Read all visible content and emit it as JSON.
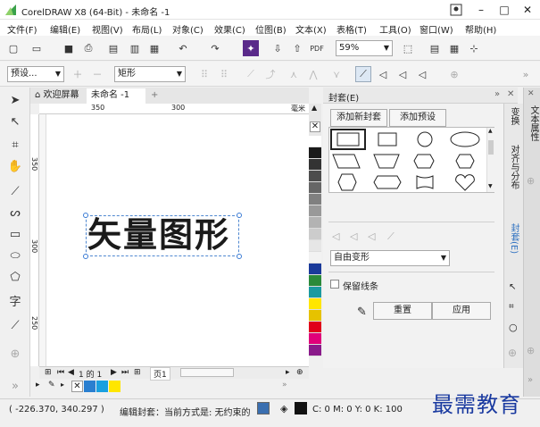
{
  "window": {
    "title": "CorelDRAW X8 (64-Bit) - 未命名 -1",
    "minimize": "–",
    "maximize": "□",
    "close": "✕"
  },
  "menu": [
    "文件(F)",
    "编辑(E)",
    "视图(V)",
    "布局(L)",
    "对象(C)",
    "效果(C)",
    "位图(B)",
    "文本(X)",
    "表格(T)",
    "工具(O)",
    "窗口(W)",
    "帮助(H)"
  ],
  "toolbar": {
    "zoom": "59%"
  },
  "propbar": {
    "preset": "预设...",
    "shape": "矩形"
  },
  "doctabs": {
    "home": "欢迎屏幕",
    "doc": "未命名 -1",
    "add": "+"
  },
  "rulers": {
    "h": [
      "350",
      "300",
      "毫米"
    ],
    "v": [
      "350",
      "300",
      "250"
    ]
  },
  "canvas": {
    "art_text": "矢量图形"
  },
  "pagebar": {
    "page_info": "1 的 1",
    "page_tab": "页1"
  },
  "panel": {
    "title": "封套(E)",
    "add_envelope": "添加新封套",
    "add_preset": "添加预设",
    "mode": "自由变形",
    "keep_lines": "保留线条",
    "reset": "重置",
    "apply": "应用"
  },
  "sidetabs": {
    "transform": "变换",
    "align": "对齐与分布",
    "envelope": "封套(E)"
  },
  "righttabs": {
    "text_props": "文本属性"
  },
  "statusbar": {
    "coords": "( -226.370, 340.297 )",
    "status": "编辑封套：当前方式是: 无约束的",
    "color": "C: 0 M: 0 Y: 0 K: 100"
  },
  "watermark": "最需教育",
  "colors": {
    "accent": "#2b6fc0",
    "selection": "#3a7bd5"
  }
}
